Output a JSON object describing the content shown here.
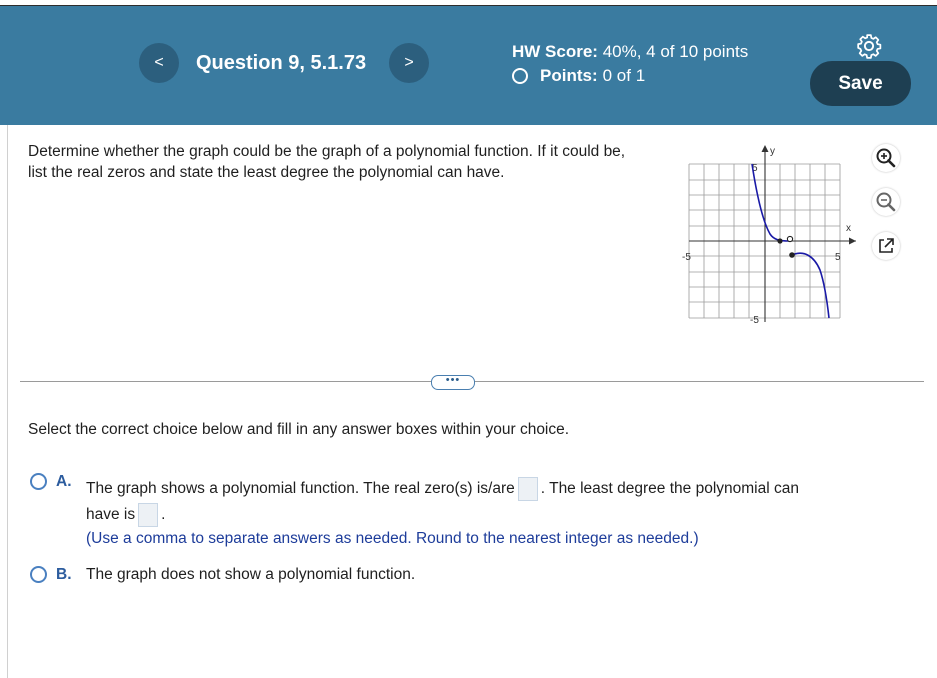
{
  "header": {
    "question_title": "Question 9, 5.1.73",
    "prev_label": "<",
    "next_label": ">",
    "hw_score_label": "HW Score:",
    "hw_score_value": "40%, 4 of 10 points",
    "points_label": "Points:",
    "points_value": "0 of 1",
    "save_label": "Save"
  },
  "question": {
    "text": "Determine whether the graph could be the graph of a polynomial function. If it could be, list the real zeros and state the least degree the polynomial can have."
  },
  "graph": {
    "x_label": "x",
    "y_label": "y",
    "tick_neg_x": "-5",
    "tick_pos_x": "5",
    "tick_pos_y": "5",
    "tick_neg_y": "-5",
    "curve_color": "#1a1aa6"
  },
  "instructions": "Select the correct choice below and fill in any answer boxes within your choice.",
  "choices": {
    "a": {
      "letter": "A.",
      "text_1": "The graph shows a polynomial function. The real zero(s) is/are",
      "text_2": ". The least degree the polynomial can",
      "text_3": "have is",
      "text_4": ".",
      "note": "(Use a comma to separate answers as needed.  Round to the nearest integer as needed.)"
    },
    "b": {
      "letter": "B.",
      "text": "The graph does not show a polynomial function."
    }
  },
  "colors": {
    "header_bg": "#3a7ba0",
    "save_bg": "#1e3f52",
    "accent": "#2c5c9e"
  }
}
